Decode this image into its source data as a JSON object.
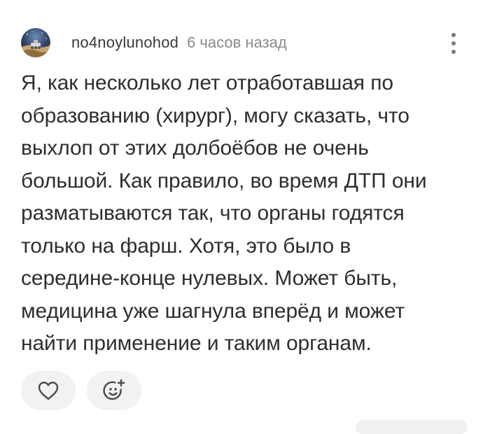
{
  "comment": {
    "author": {
      "username": "no4noylunohod",
      "avatar_icon": "avatar-image"
    },
    "timestamp": "6 часов назад",
    "text": "Я, как несколько лет отработавшая по\nобразованию (хирург), могу сказать, что\nвыхлоп от этих долбоёбов не очень\nбольшой. Как правило, во время ДТП они\nразматываются так, что органы годятся\nтолько на фарш. Хотя, это было в\nсередине-конце нулевых. Может быть,\nмедицина уже шагнула вперёд и может\nнайти применение и таким органам.",
    "actions": {
      "like_icon": "heart-icon",
      "reaction_icon": "add-emoji-icon"
    },
    "menu_icon": "more-vertical-icon"
  },
  "colors": {
    "text": "#2e2e2e",
    "username": "#3a3a3a",
    "timestamp": "#8a8a8a",
    "action_bg": "#f1f2f4",
    "icon": "#4a4a4a"
  }
}
